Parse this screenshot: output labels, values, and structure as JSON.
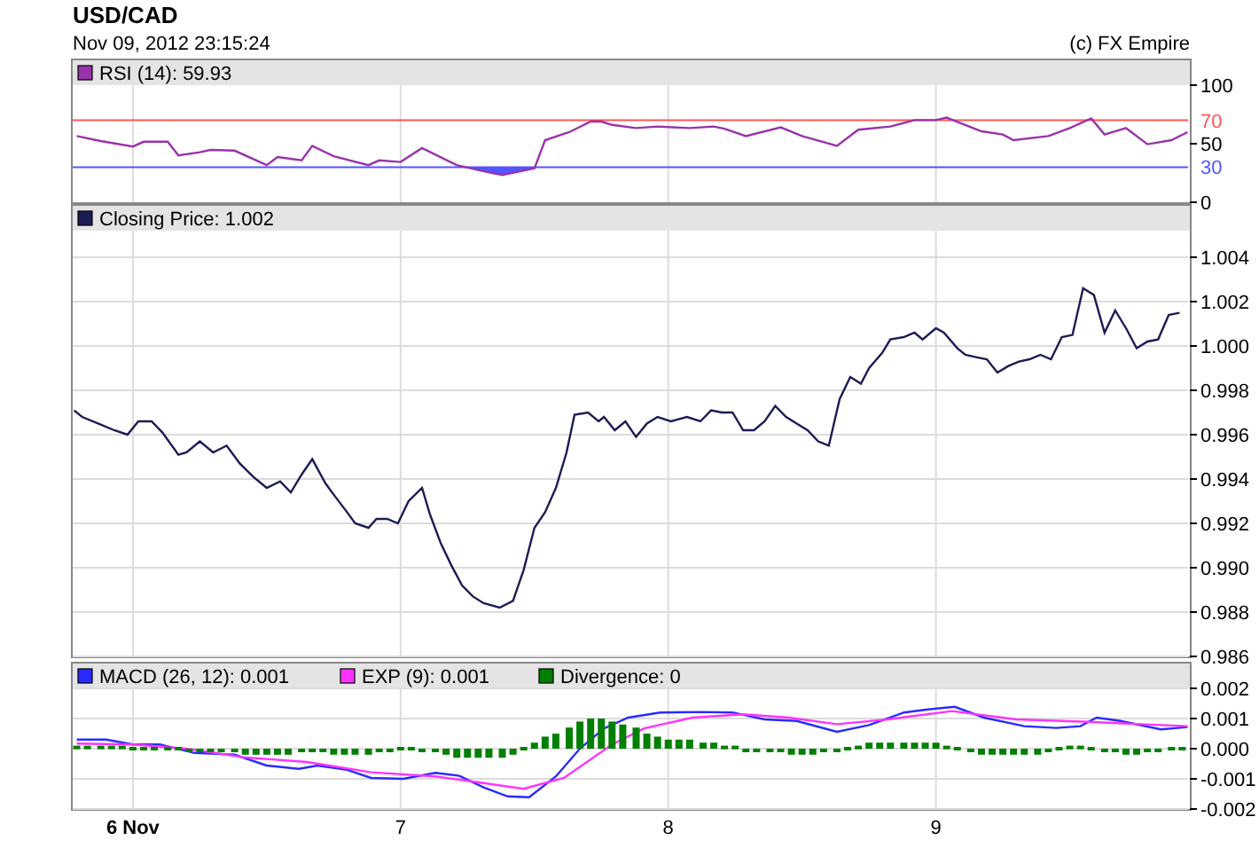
{
  "title": "USD/CAD",
  "timestamp": "Nov 09, 2012 23:15:24",
  "copyright": "(c) FX Empire",
  "rsi": {
    "legend_values": [
      "59.93"
    ],
    "chart_data": {
      "type": "line",
      "xlim": [
        5.775,
        9.942
      ],
      "ylim": [
        0,
        100
      ],
      "yticks": [
        0,
        50,
        100
      ],
      "x": [
        5.79,
        5.88,
        6,
        6.04,
        6.13,
        6.17,
        6.25,
        6.29,
        6.38,
        6.5,
        6.54,
        6.63,
        6.67,
        6.75,
        6.88,
        6.92,
        7,
        7.08,
        7.21,
        7.33,
        7.38,
        7.5,
        7.54,
        7.63,
        7.71,
        7.75,
        7.79,
        7.88,
        7.96,
        8.08,
        8.17,
        8.21,
        8.29,
        8.42,
        8.5,
        8.63,
        8.71,
        8.83,
        8.92,
        9,
        9.04,
        9.17,
        9.25,
        9.29,
        9.42,
        9.5,
        9.58,
        9.63,
        9.71,
        9.79,
        9.88,
        9.94
      ],
      "series": [
        {
          "name": "RSI (14):",
          "color": "#9933aa",
          "values": [
            56.5,
            52.3,
            47.5,
            51.6,
            51.6,
            40,
            42.7,
            44.7,
            44.1,
            31.7,
            38.6,
            35.8,
            48.2,
            39.3,
            31.7,
            35.8,
            34.4,
            46.2,
            31.7,
            25.5,
            23.4,
            28.9,
            53,
            59.9,
            68.9,
            68.9,
            66.1,
            63.4,
            64.7,
            63.4,
            64.7,
            62.7,
            56.5,
            64,
            56.5,
            48.2,
            62,
            64.7,
            70.2,
            70.2,
            72.3,
            60.6,
            57.9,
            53,
            56.5,
            63.4,
            71.6,
            57.9,
            63.4,
            49.6,
            53,
            59.9
          ]
        }
      ],
      "ref_lines": [
        {
          "axis": "y",
          "value": 70,
          "label": "70",
          "color": "#ff5555"
        },
        {
          "axis": "y",
          "value": 30,
          "label": "30",
          "color": "#5555ff"
        }
      ],
      "grid": true
    }
  },
  "price": {
    "legend_values": [
      "1.002"
    ],
    "chart_data": {
      "type": "line",
      "xlim": [
        5.775,
        9.942
      ],
      "ylim": [
        0.986,
        1.0052
      ],
      "yticks": [
        0.986,
        0.988,
        {
          "value": 0.99,
          "label": "0.990"
        },
        0.992,
        0.994,
        0.996,
        0.998,
        {
          "value": 1,
          "label": "1.000"
        },
        1.002,
        1.004
      ],
      "x": [
        5.78,
        5.81,
        5.87,
        5.93,
        5.98,
        6.02,
        6.07,
        6.11,
        6.17,
        6.2,
        6.25,
        6.3,
        6.35,
        6.4,
        6.45,
        6.5,
        6.55,
        6.59,
        6.63,
        6.67,
        6.72,
        6.75,
        6.8,
        6.83,
        6.88,
        6.91,
        6.95,
        6.99,
        7.03,
        7.08,
        7.11,
        7.15,
        7.19,
        7.23,
        7.27,
        7.31,
        7.37,
        7.42,
        7.46,
        7.5,
        7.54,
        7.58,
        7.62,
        7.65,
        7.7,
        7.74,
        7.76,
        7.8,
        7.84,
        7.88,
        7.92,
        7.96,
        8.01,
        8.07,
        8.12,
        8.16,
        8.2,
        8.24,
        8.28,
        8.32,
        8.36,
        8.4,
        8.44,
        8.48,
        8.52,
        8.56,
        8.6,
        8.64,
        8.68,
        8.72,
        8.75,
        8.8,
        8.83,
        8.88,
        8.92,
        8.95,
        9,
        9.03,
        9.08,
        9.11,
        9.15,
        9.19,
        9.23,
        9.27,
        9.31,
        9.35,
        9.39,
        9.43,
        9.47,
        9.51,
        9.55,
        9.59,
        9.63,
        9.67,
        9.71,
        9.75,
        9.79,
        9.83,
        9.87,
        9.91
      ],
      "series": [
        {
          "name": "Closing Price:",
          "color": "#1c1c55",
          "values": [
            0.9971,
            0.9968,
            0.9965,
            0.9962,
            0.996,
            0.9966,
            0.9966,
            0.9961,
            0.9951,
            0.9952,
            0.9957,
            0.9952,
            0.9955,
            0.9947,
            0.9941,
            0.9936,
            0.9939,
            0.9934,
            0.9942,
            0.9949,
            0.9938,
            0.9933,
            0.9925,
            0.992,
            0.9918,
            0.9922,
            0.9922,
            0.992,
            0.993,
            0.9936,
            0.9924,
            0.9911,
            0.9901,
            0.9892,
            0.9887,
            0.9884,
            0.9882,
            0.9885,
            0.9899,
            0.9918,
            0.9925,
            0.9936,
            0.9952,
            0.9969,
            0.997,
            0.9966,
            0.9968,
            0.9962,
            0.9966,
            0.9959,
            0.9965,
            0.9968,
            0.9966,
            0.9968,
            0.9966,
            0.9971,
            0.997,
            0.997,
            0.9962,
            0.9962,
            0.9966,
            0.9973,
            0.9968,
            0.9965,
            0.9962,
            0.9957,
            0.9955,
            0.9976,
            0.9986,
            0.9983,
            0.999,
            0.9997,
            1.0003,
            1.0004,
            1.0006,
            1.0003,
            1.0008,
            1.0006,
            0.9999,
            0.9996,
            0.9995,
            0.9994,
            0.9988,
            0.9991,
            0.9993,
            0.9994,
            0.9996,
            0.9994,
            1.0004,
            1.0005,
            1.0026,
            1.0023,
            1.0006,
            1.0016,
            1.0008,
            0.9999,
            1.0002,
            1.0003,
            1.0014,
            1.0015
          ]
        }
      ],
      "grid": true
    }
  },
  "macd": {
    "legend_values": [
      "0.001",
      "0.001",
      "0"
    ],
    "chart_data": {
      "type": "line",
      "xlim": [
        5.775,
        9.942
      ],
      "ylim": [
        -0.002,
        0.002
      ],
      "yticks": [
        -0.002,
        -0.001,
        {
          "value": 0,
          "label": "0.000"
        },
        0.001,
        0.002
      ],
      "xticks": [
        {
          "value": 6,
          "label": "6 Nov"
        },
        7,
        8,
        9
      ],
      "grid": true,
      "series": [
        {
          "name": "MACD (26, 12):",
          "color": "#2a2aff",
          "type": "line",
          "x": [
            5.79,
            5.9,
            6,
            6.1,
            6.23,
            6.38,
            6.5,
            6.62,
            6.69,
            6.8,
            6.89,
            7.01,
            7.13,
            7.22,
            7.31,
            7.4,
            7.48,
            7.58,
            7.67,
            7.76,
            7.85,
            7.97,
            8.12,
            8.24,
            8.36,
            8.48,
            8.63,
            8.75,
            8.88,
            8.97,
            9.07,
            9.18,
            9.33,
            9.45,
            9.54,
            9.6,
            9.69,
            9.84,
            9.94
          ],
          "values": [
            0.0003,
            0.0003,
            0.00014,
            0.00014,
            -0.00014,
            -0.0002,
            -0.00056,
            -0.00067,
            -0.00056,
            -0.0007,
            -0.00097,
            -0.001,
            -0.0008,
            -0.0009,
            -0.00128,
            -0.00158,
            -0.00161,
            -0.00092,
            0,
            0.00067,
            0.00103,
            0.0012,
            0.00122,
            0.0012,
            0.00097,
            0.00092,
            0.00056,
            0.00078,
            0.0012,
            0.0013,
            0.00139,
            0.00103,
            0.00075,
            0.00069,
            0.00075,
            0.00103,
            0.00092,
            0.00064,
            0.00072
          ]
        },
        {
          "name": "EXP (9):",
          "color": "#ff33ff",
          "type": "line",
          "x": [
            5.79,
            6,
            6.2,
            6.41,
            6.65,
            6.89,
            7.13,
            7.31,
            7.46,
            7.61,
            7.79,
            7.91,
            8.09,
            8.28,
            8.45,
            8.63,
            8.82,
            9.06,
            9.3,
            9.57,
            9.94
          ],
          "values": [
            0.00017,
            0.00014,
            0,
            -0.00028,
            -0.00044,
            -0.00078,
            -0.00092,
            -0.00114,
            -0.00133,
            -0.00097,
            0.00014,
            0.00067,
            0.00103,
            0.00114,
            0.00103,
            0.00081,
            0.00097,
            0.00125,
            0.00097,
            0.00089,
            0.00075
          ]
        },
        {
          "name": "Divergence:",
          "color": "#008000",
          "type": "bar",
          "x": [
            5.79,
            5.83,
            5.88,
            5.92,
            5.96,
            6,
            6.04,
            6.08,
            6.13,
            6.17,
            6.21,
            6.25,
            6.29,
            6.33,
            6.38,
            6.42,
            6.46,
            6.5,
            6.54,
            6.58,
            6.63,
            6.67,
            6.71,
            6.75,
            6.79,
            6.83,
            6.88,
            6.92,
            6.96,
            7,
            7.04,
            7.08,
            7.13,
            7.17,
            7.21,
            7.25,
            7.29,
            7.33,
            7.38,
            7.42,
            7.46,
            7.5,
            7.54,
            7.58,
            7.63,
            7.67,
            7.71,
            7.75,
            7.79,
            7.83,
            7.88,
            7.92,
            7.96,
            8,
            8.04,
            8.08,
            8.13,
            8.17,
            8.21,
            8.25,
            8.29,
            8.33,
            8.38,
            8.42,
            8.46,
            8.5,
            8.54,
            8.58,
            8.63,
            8.67,
            8.71,
            8.75,
            8.79,
            8.83,
            8.88,
            8.92,
            8.96,
            9,
            9.04,
            9.08,
            9.13,
            9.17,
            9.21,
            9.25,
            9.29,
            9.33,
            9.38,
            9.42,
            9.46,
            9.5,
            9.54,
            9.58,
            9.63,
            9.67,
            9.71,
            9.75,
            9.79,
            9.83,
            9.88,
            9.92
          ],
          "values": [
            0.0001,
            0.0001,
            0.0001,
            0.0001,
            0.0001,
            0,
            0,
            0,
            0,
            0,
            -0.0001,
            -0.0001,
            -0.0001,
            -0.0001,
            -0.0001,
            -0.0002,
            -0.0002,
            -0.0002,
            -0.0002,
            -0.0002,
            -0.0001,
            -0.0001,
            -0.0001,
            -0.0002,
            -0.0002,
            -0.0002,
            -0.0002,
            -0.0001,
            -0.0001,
            0,
            0,
            -0.0001,
            -0.0001,
            -0.0002,
            -0.0003,
            -0.0003,
            -0.0003,
            -0.0003,
            -0.0003,
            -0.0002,
            0,
            0.0002,
            0.0004,
            0.0005,
            0.0007,
            0.0009,
            0.001,
            0.001,
            0.0009,
            0.0008,
            0.0007,
            0.0005,
            0.0004,
            0.0003,
            0.0003,
            0.0003,
            0.0002,
            0.0002,
            0.0001,
            0.0001,
            -0.0001,
            -0.0001,
            -0.0001,
            -0.0001,
            -0.0002,
            -0.0002,
            -0.0002,
            -0.0001,
            -0.0001,
            0,
            0.0001,
            0.0002,
            0.0002,
            0.0002,
            0.0002,
            0.0002,
            0.0002,
            0.0002,
            0.0001,
            0,
            -0.0001,
            -0.0002,
            -0.0002,
            -0.0002,
            -0.0002,
            -0.0002,
            -0.0002,
            -0.0001,
            0,
            0.0001,
            0.0001,
            0,
            -0.0001,
            -0.0001,
            -0.0002,
            -0.0002,
            -0.0001,
            -0.0001,
            0,
            0
          ]
        }
      ]
    }
  }
}
